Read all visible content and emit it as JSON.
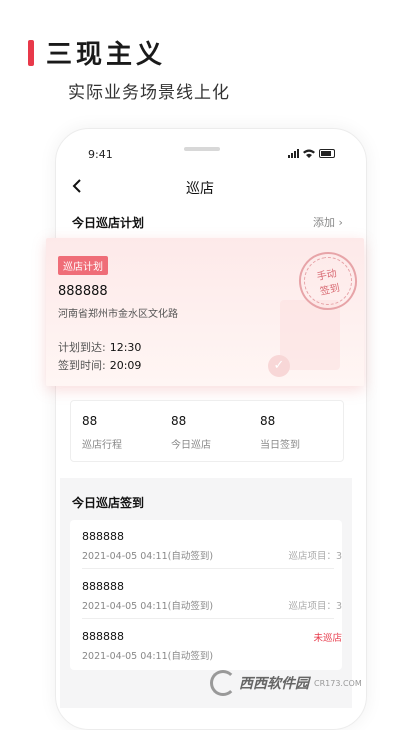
{
  "promo": {
    "title": "三现主义",
    "subtitle": "实际业务场景线上化",
    "accent": "#e8394a"
  },
  "status_bar": {
    "time": "9:41"
  },
  "nav": {
    "back_icon": "chevron-left-icon",
    "title": "巡店"
  },
  "plan_section": {
    "title": "今日巡店计划",
    "add_label": "添加 ›"
  },
  "plan_card": {
    "tag": "巡店计划",
    "name": "888888",
    "address": "河南省郑州市金水区文化路",
    "arrival_label": "计划到达:",
    "arrival_time": "12:30",
    "signin_label": "签到时间:",
    "signin_time": "20:09",
    "stamp_line1": "手动",
    "stamp_line2": "签到"
  },
  "stats": [
    {
      "value": "88",
      "label": "巡店行程"
    },
    {
      "value": "88",
      "label": "今日巡店"
    },
    {
      "value": "88",
      "label": "当日签到"
    }
  ],
  "signin_section": {
    "title": "今日巡店签到"
  },
  "signin_rows": [
    {
      "name": "888888",
      "date": "2021-04-05 04:11(自动签到)",
      "status": "巡店项目：3"
    },
    {
      "name": "888888",
      "date": "2021-04-05 04:11(自动签到)",
      "status": "巡店项目：3"
    },
    {
      "name": "888888",
      "date": "2021-04-05 04:11(自动签到)",
      "status": "未巡店"
    }
  ],
  "watermark": {
    "text": "西西软件园",
    "url": "CR173.COM"
  }
}
